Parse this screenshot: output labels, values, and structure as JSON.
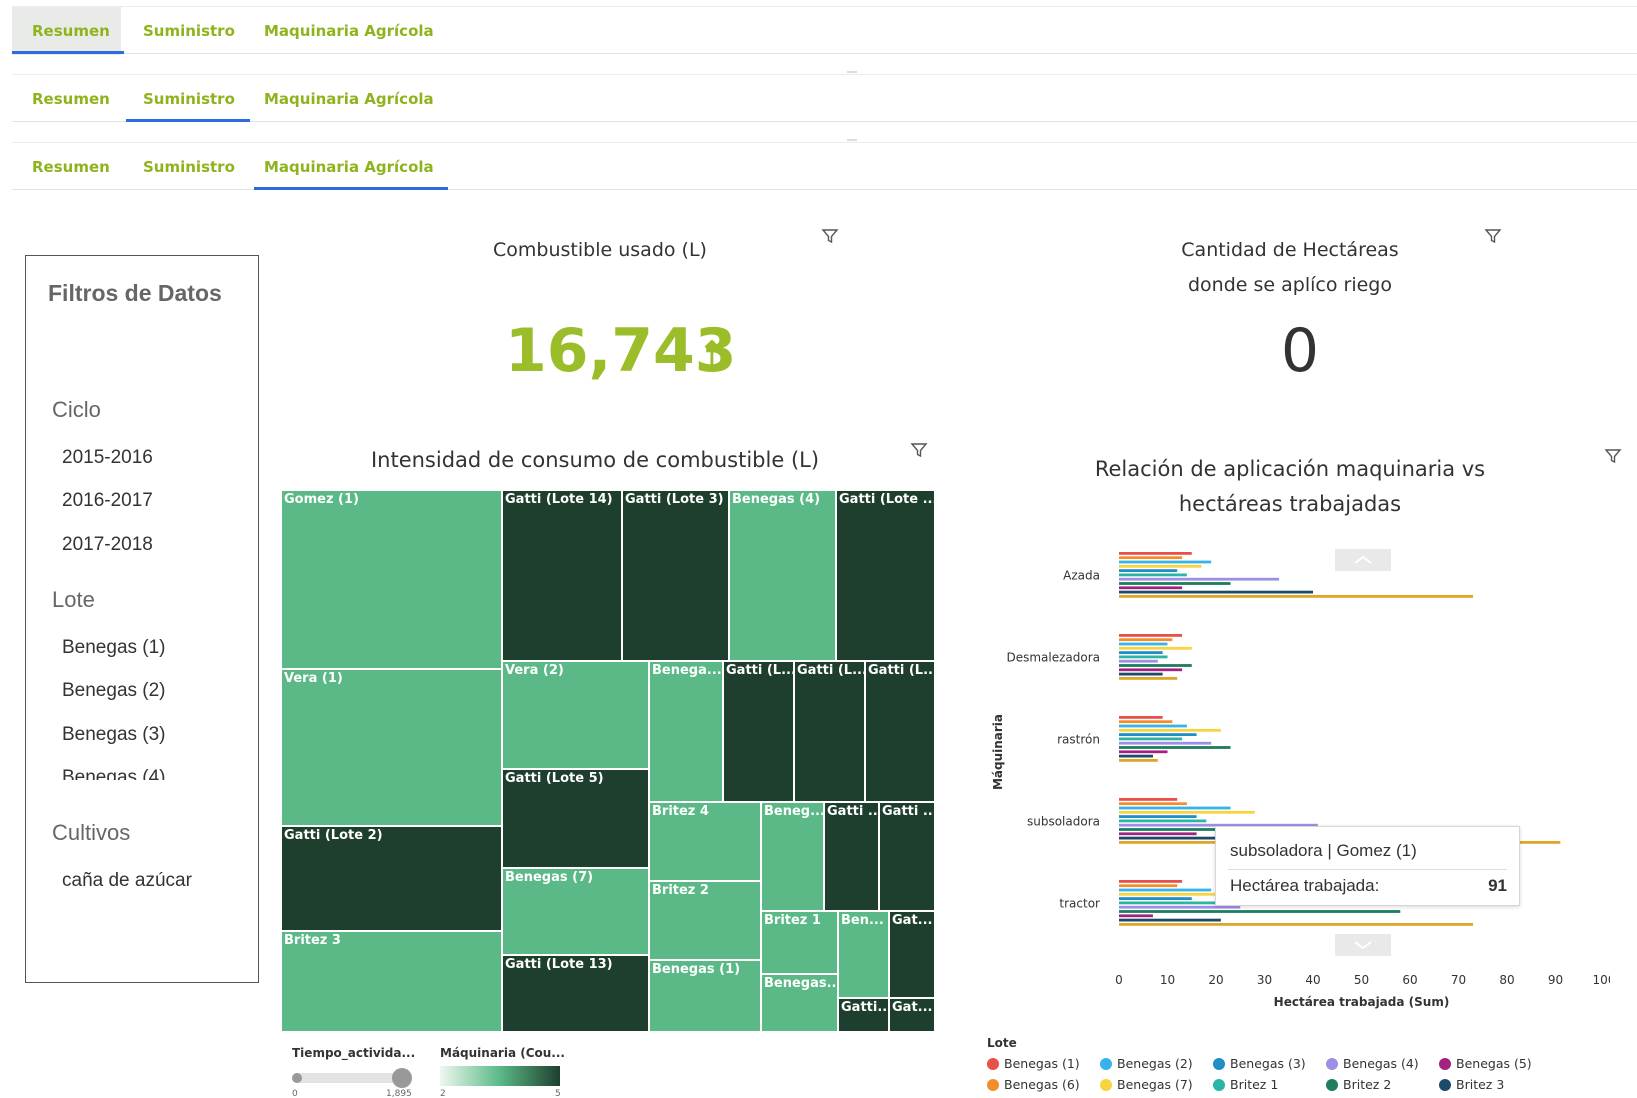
{
  "tabs": [
    "Resumen",
    "Suministro",
    "Maquinaria Agrícola"
  ],
  "filters": {
    "title": "Filtros de Datos",
    "ciclo_label": "Ciclo",
    "ciclo": [
      "2015-2016",
      "2016-2017",
      "2017-2018"
    ],
    "lote_label": "Lote",
    "lote": [
      "Benegas (1)",
      "Benegas (2)",
      "Benegas (3)",
      "Benegas (4)"
    ],
    "cultivos_label": "Cultivos",
    "cultivos": [
      "caña de azúcar"
    ]
  },
  "kpi_fuel": {
    "title": "Combustible usado (L)",
    "value": "16,743",
    "arrow": "↑",
    "color": "#9cbd2a"
  },
  "kpi_hectares": {
    "title_line1": "Cantidad de Hectáreas",
    "title_line2": "donde se aplíco riego",
    "value": "0"
  },
  "treemap": {
    "title": "Intensidad de consumo de combustible (L)",
    "legend_time": "Tiempo_activida...",
    "legend_time_min": "0",
    "legend_time_max": "1,895",
    "legend_maq": "Máquinaria (Cou...",
    "legend_maq_min": "2",
    "legend_maq_max": "5",
    "cells": [
      {
        "label": "Gomez (1)",
        "shade": "light"
      },
      {
        "label": "Vera (1)",
        "shade": "light"
      },
      {
        "label": "Gatti (Lote 2)",
        "shade": "dark"
      },
      {
        "label": "Britez 3",
        "shade": "light"
      },
      {
        "label": "Gatti (Lote 14)",
        "shade": "dark"
      },
      {
        "label": "Gatti (Lote 3)",
        "shade": "dark"
      },
      {
        "label": "Benegas (4)",
        "shade": "light"
      },
      {
        "label": "Gatti (Lote ...",
        "shade": "dark"
      },
      {
        "label": "Vera (2)",
        "shade": "light"
      },
      {
        "label": "Gatti (Lote 5)",
        "shade": "dark"
      },
      {
        "label": "Benegas (7)",
        "shade": "light"
      },
      {
        "label": "Gatti (Lote 13)",
        "shade": "dark"
      },
      {
        "label": "Benega...",
        "shade": "light"
      },
      {
        "label": "Gatti (L...",
        "shade": "dark"
      },
      {
        "label": "Gatti (L...",
        "shade": "dark"
      },
      {
        "label": "Gatti (L...",
        "shade": "dark"
      },
      {
        "label": "Britez 4",
        "shade": "light"
      },
      {
        "label": "Britez 2",
        "shade": "light"
      },
      {
        "label": "Benegas (1)",
        "shade": "light"
      },
      {
        "label": "Beneg...",
        "shade": "light"
      },
      {
        "label": "Gatti ...",
        "shade": "dark"
      },
      {
        "label": "Gatti ...",
        "shade": "dark"
      },
      {
        "label": "Britez 1",
        "shade": "light"
      },
      {
        "label": "Ben...",
        "shade": "light"
      },
      {
        "label": "Gat...",
        "shade": "dark"
      },
      {
        "label": "Benegas...",
        "shade": "light"
      },
      {
        "label": "Gatti...",
        "shade": "dark"
      },
      {
        "label": "Gat...",
        "shade": "dark"
      }
    ]
  },
  "colors": {
    "light": "#5bb987",
    "dark": "#1f3f2e",
    "accent": "#8fb31d",
    "tab_underline": "#2d6cdf"
  },
  "bar_chart": {
    "title_line1": "Relación de aplicación maquinaria vs",
    "title_line2": "hectáreas trabajadas",
    "ylabel": "Máquinaria",
    "xlabel": "Hectárea trabajada (Sum)",
    "legend_title": "Lote",
    "tooltip_head": "subsoladora | Gomez (1)",
    "tooltip_key": "Hectárea trabajada:",
    "tooltip_val": "91"
  },
  "chart_data": {
    "type": "bar",
    "orientation": "horizontal",
    "categories": [
      "Azada",
      "Desmalezadora",
      "rastrón",
      "subsoladora",
      "tractor"
    ],
    "xlim": [
      0,
      100
    ],
    "xticks": [
      0,
      10,
      20,
      30,
      40,
      50,
      60,
      70,
      80,
      90,
      100
    ],
    "xlabel": "Hectárea trabajada (Sum)",
    "ylabel": "Máquinaria",
    "legend_position": "bottom",
    "series": [
      {
        "name": "Benegas (1)",
        "color": "#e8514a",
        "values": [
          15,
          13,
          9,
          12,
          13
        ]
      },
      {
        "name": "Benegas (6)",
        "color": "#f28e2c",
        "values": [
          13,
          11,
          11,
          14,
          12
        ]
      },
      {
        "name": "Benegas (2)",
        "color": "#35b3ea",
        "values": [
          19,
          10,
          14,
          23,
          19
        ]
      },
      {
        "name": "Benegas (7)",
        "color": "#f7d43e",
        "values": [
          17,
          15,
          21,
          28,
          42
        ]
      },
      {
        "name": "Benegas (3)",
        "color": "#1f8fc4",
        "values": [
          12,
          9,
          16,
          16,
          15
        ]
      },
      {
        "name": "Britez 1",
        "color": "#2bb5a6",
        "values": [
          14,
          10,
          13,
          18,
          20
        ]
      },
      {
        "name": "Benegas (4)",
        "color": "#9d8fe6",
        "values": [
          33,
          8,
          19,
          41,
          25
        ]
      },
      {
        "name": "Britez 2",
        "color": "#1e7c60",
        "values": [
          23,
          15,
          23,
          33,
          58
        ]
      },
      {
        "name": "Benegas (5)",
        "color": "#a2237f",
        "values": [
          13,
          13,
          10,
          16,
          7
        ]
      },
      {
        "name": "Britez 3",
        "color": "#1b4a6b",
        "values": [
          40,
          9,
          7,
          50,
          21
        ]
      },
      {
        "name": "Gomez (1)",
        "color": "#e0a526",
        "values": [
          73,
          12,
          8,
          91,
          73
        ]
      }
    ]
  }
}
